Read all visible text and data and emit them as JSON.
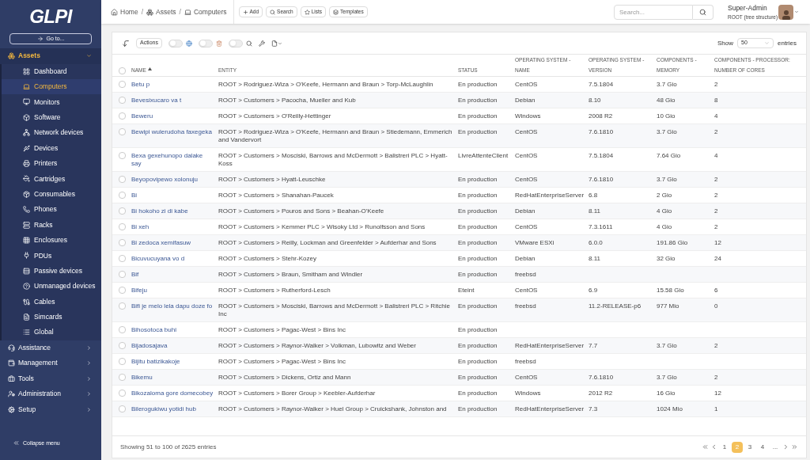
{
  "logo": "GLPI",
  "goto": "Go to...",
  "sidebar": [
    {
      "label": "Assets",
      "selected": true,
      "expanded": true,
      "children": [
        {
          "label": "Dashboard",
          "selected": false
        },
        {
          "label": "Computers",
          "selected": true
        },
        {
          "label": "Monitors",
          "selected": false
        },
        {
          "label": "Software",
          "selected": false
        },
        {
          "label": "Network devices",
          "selected": false
        },
        {
          "label": "Devices",
          "selected": false
        },
        {
          "label": "Printers",
          "selected": false
        },
        {
          "label": "Cartridges",
          "selected": false
        },
        {
          "label": "Consumables",
          "selected": false
        },
        {
          "label": "Phones",
          "selected": false
        },
        {
          "label": "Racks",
          "selected": false
        },
        {
          "label": "Enclosures",
          "selected": false
        },
        {
          "label": "PDUs",
          "selected": false
        },
        {
          "label": "Passive devices",
          "selected": false
        },
        {
          "label": "Unmanaged devices",
          "selected": false
        },
        {
          "label": "Cables",
          "selected": false
        },
        {
          "label": "Simcards",
          "selected": false
        },
        {
          "label": "Global",
          "selected": false
        }
      ]
    },
    {
      "label": "Assistance",
      "selected": false,
      "expanded": false
    },
    {
      "label": "Management",
      "selected": false,
      "expanded": false
    },
    {
      "label": "Tools",
      "selected": false,
      "expanded": false
    },
    {
      "label": "Administration",
      "selected": false,
      "expanded": false
    },
    {
      "label": "Setup",
      "selected": false,
      "expanded": false
    }
  ],
  "collapse": "Collapse menu",
  "breadcrumb": [
    {
      "label": "Home"
    },
    {
      "sep": "/",
      "label": "Assets"
    },
    {
      "sep": "/",
      "label": "Computers"
    }
  ],
  "header_buttons": [
    "Add",
    "Search",
    "Lists",
    "Templates"
  ],
  "search": {
    "placeholder": "Search..."
  },
  "user": {
    "name": "Super-Admin",
    "entity": "ROOT (tree structure)"
  },
  "toolbar": {
    "actions": "Actions",
    "toggles": [
      {
        "on": false
      },
      {
        "on": false
      },
      {
        "on": false
      }
    ],
    "show": "Show",
    "page_size": "50",
    "entries": "entries"
  },
  "table": {
    "select_all": {
      "checked": false
    },
    "columns": [
      "NAME",
      "ENTITY",
      "STATUS",
      "OPERATING SYSTEM - NAME",
      "OPERATING SYSTEM - VERSION",
      "COMPONENTS - MEMORY",
      "COMPONENTS - PROCESSOR: NUMBER OF CORES"
    ],
    "rows": [
      {
        "checked": false,
        "cells": [
          "Betu p",
          "ROOT > Rodriguez-Wiza > O'Keefe, Hermann and Braun > Torp-McLaughlin",
          "En production",
          "CentOS",
          "7.5.1804",
          "3.7 Gio",
          "2"
        ]
      },
      {
        "checked": false,
        "cells": [
          "Bevesixucaro va t",
          "ROOT > Customers > Pacocha, Mueller and Kub",
          "En production",
          "Debian",
          "8.10",
          "48 Gio",
          "8"
        ]
      },
      {
        "checked": false,
        "cells": [
          "Beweru",
          "ROOT > Customers > O'Reilly-Hettinger",
          "En production",
          "Windows",
          "2008 R2",
          "10 Gio",
          "4"
        ]
      },
      {
        "checked": false,
        "cells": [
          "Bewipi wulerudoha faxegeka",
          "ROOT > Rodriguez-Wiza > O'Keefe, Hermann and Braun > Stiedemann, Emmerich and Vandervort",
          "En production",
          "CentOS",
          "7.6.1810",
          "3.7 Gio",
          "2"
        ]
      },
      {
        "checked": false,
        "cells": [
          "Bexa gexehunopo dalake say",
          "ROOT > Customers > Mosciski, Barrows and McDermott > Balistreri PLC > Hyatt-Koss",
          "LivreAttenteClient",
          "CentOS",
          "7.5.1804",
          "7.64 Gio",
          "4"
        ]
      },
      {
        "checked": false,
        "cells": [
          "Beyopovipewo xolonuju",
          "ROOT > Customers > Hyatt-Leuschke",
          "En production",
          "CentOS",
          "7.6.1810",
          "3.7 Gio",
          "2"
        ]
      },
      {
        "checked": false,
        "cells": [
          "Bi",
          "ROOT > Customers > Shanahan-Paucek",
          "En production",
          "RedHatEnterpriseServer",
          "6.8",
          "2 Gio",
          "2"
        ]
      },
      {
        "checked": false,
        "cells": [
          "Bi hokoho zi di kabe",
          "ROOT > Customers > Pouros and Sons > Beahan-O'Keefe",
          "En production",
          "Debian",
          "8.11",
          "4 Gio",
          "2"
        ]
      },
      {
        "checked": false,
        "cells": [
          "Bi xeh",
          "ROOT > Customers > Kemmer PLC > Wisoky Ltd > Runolfsson and Sons",
          "En production",
          "CentOS",
          "7.3.1611",
          "4 Gio",
          "2"
        ]
      },
      {
        "checked": false,
        "cells": [
          "Bi zedoca xemifasuw",
          "ROOT > Customers > Reilly, Lockman and Greenfelder > Aufderhar and Sons",
          "En production",
          "VMware ESXi",
          "6.0.0",
          "191.86 Gio",
          "12"
        ]
      },
      {
        "checked": false,
        "cells": [
          "Bicuvucuyana vo d",
          "ROOT > Customers > Stehr-Kozey",
          "En production",
          "Debian",
          "8.11",
          "32 Gio",
          "24"
        ]
      },
      {
        "checked": false,
        "cells": [
          "Bif",
          "ROOT > Customers > Braun, Smitham and Windler",
          "En production",
          "freebsd",
          "",
          "",
          ""
        ]
      },
      {
        "checked": false,
        "cells": [
          "Bifeju",
          "ROOT > Customers > Rutherford-Lesch",
          "Eteint",
          "CentOS",
          "6.9",
          "15.58 Gio",
          "6"
        ]
      },
      {
        "checked": false,
        "cells": [
          "Bifi je melo lela dapu doze fo",
          "ROOT > Customers > Mosciski, Barrows and McDermott > Balistreri PLC > Ritchie Inc",
          "En production",
          "freebsd",
          "11.2-RELEASE-p6",
          "977 Mio",
          "0"
        ]
      },
      {
        "checked": false,
        "cells": [
          "Bihosotoca buhi",
          "ROOT > Customers > Pagac-West > Bins Inc",
          "En production",
          "",
          "",
          "",
          ""
        ]
      },
      {
        "checked": false,
        "cells": [
          "Bijadosajava",
          "ROOT > Customers > Raynor-Walker > Volkman, Lubowitz and Weber",
          "En production",
          "RedHatEnterpriseServer",
          "7.7",
          "3.7 Gio",
          "2"
        ]
      },
      {
        "checked": false,
        "cells": [
          "Bijitu batizikakoje",
          "ROOT > Customers > Pagac-West > Bins Inc",
          "En production",
          "freebsd",
          "",
          "",
          ""
        ]
      },
      {
        "checked": false,
        "cells": [
          "Bikemu",
          "ROOT > Customers > Dickens, Ortiz and Mann",
          "En production",
          "CentOS",
          "7.6.1810",
          "3.7 Gio",
          "2"
        ]
      },
      {
        "checked": false,
        "cells": [
          "Bikozaloma gore domecobey",
          "ROOT > Customers > Borer Group > Keebler-Aufderhar",
          "En production",
          "Windows",
          "2012 R2",
          "16 Gio",
          "12"
        ]
      },
      {
        "checked": false,
        "cells": [
          "Bilerogukiwu yotidi hub",
          "ROOT > Customers > Raynor-Walker > Huel Group > Cruickshank, Johnston and",
          "En production",
          "RedHatEnterpriseServer",
          "7.3",
          "1024 Mio",
          "1"
        ]
      }
    ]
  },
  "footer": {
    "info": "Showing 51 to 100 of 2625 entries",
    "pages": [
      {
        "label": "1",
        "selected": false
      },
      {
        "label": "2",
        "selected": true
      },
      {
        "label": "3",
        "selected": false
      },
      {
        "label": "4",
        "selected": false
      },
      {
        "label": "...",
        "selected": false
      }
    ]
  }
}
